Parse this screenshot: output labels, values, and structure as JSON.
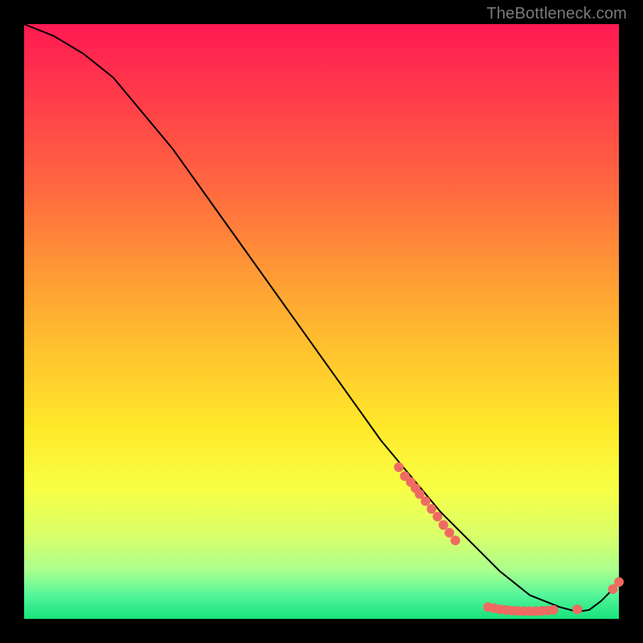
{
  "watermark": "TheBottleneck.com",
  "chart_data": {
    "type": "line",
    "title": "",
    "xlabel": "",
    "ylabel": "",
    "xlim": [
      0,
      100
    ],
    "ylim": [
      0,
      100
    ],
    "grid": false,
    "series": [
      {
        "name": "curve",
        "x": [
          0,
          5,
          10,
          15,
          20,
          25,
          30,
          35,
          40,
          45,
          50,
          55,
          60,
          65,
          70,
          75,
          80,
          85,
          90,
          93,
          95,
          97,
          100
        ],
        "y": [
          100,
          98,
          95,
          91,
          85,
          79,
          72,
          65,
          58,
          51,
          44,
          37,
          30,
          24,
          18,
          13,
          8,
          4,
          2,
          1.2,
          1.5,
          3,
          6
        ]
      }
    ],
    "markers": {
      "name": "highlighted-points",
      "color": "#ef6b62",
      "points": [
        {
          "x": 63,
          "y": 25.5
        },
        {
          "x": 64,
          "y": 24.0
        },
        {
          "x": 65,
          "y": 23.0
        },
        {
          "x": 65.8,
          "y": 22.0
        },
        {
          "x": 66.5,
          "y": 21.0
        },
        {
          "x": 67.5,
          "y": 19.8
        },
        {
          "x": 68.5,
          "y": 18.5
        },
        {
          "x": 69.5,
          "y": 17.2
        },
        {
          "x": 70.5,
          "y": 15.8
        },
        {
          "x": 71.5,
          "y": 14.5
        },
        {
          "x": 72.5,
          "y": 13.2
        },
        {
          "x": 78,
          "y": 2.0
        },
        {
          "x": 79,
          "y": 1.8
        },
        {
          "x": 80,
          "y": 1.6
        },
        {
          "x": 81,
          "y": 1.5
        },
        {
          "x": 82,
          "y": 1.4
        },
        {
          "x": 83,
          "y": 1.35
        },
        {
          "x": 84,
          "y": 1.3
        },
        {
          "x": 85,
          "y": 1.3
        },
        {
          "x": 86,
          "y": 1.3
        },
        {
          "x": 87,
          "y": 1.35
        },
        {
          "x": 88,
          "y": 1.4
        },
        {
          "x": 89,
          "y": 1.5
        },
        {
          "x": 93,
          "y": 1.6
        },
        {
          "x": 99,
          "y": 5.0
        },
        {
          "x": 100,
          "y": 6.2
        }
      ]
    }
  }
}
